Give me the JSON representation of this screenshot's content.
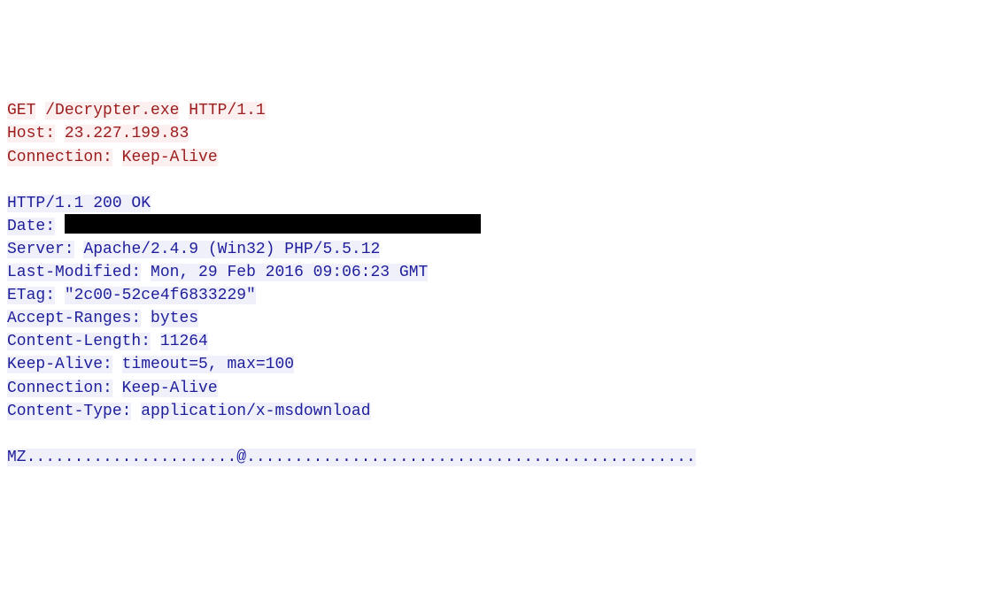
{
  "request": {
    "line1_method": "GET",
    "line1_path": "/Decrypter.exe",
    "line1_proto": "HTTP/1.1",
    "host_label": "Host:",
    "host_value": "23.227.199.83",
    "conn_label": "Connection:",
    "conn_value": "Keep-Alive"
  },
  "response": {
    "status": "HTTP/1.1 200 OK",
    "date_label": "Date:",
    "server_label": "Server:",
    "server_value": "Apache/2.4.9 (Win32) PHP/5.5.12",
    "lastmod_label": "Last-Modified:",
    "lastmod_value": "Mon, 29 Feb 2016 09:06:23 GMT",
    "etag_label": "ETag:",
    "etag_value": "\"2c00-52ce4f6833229\"",
    "acceptranges_label": "Accept-Ranges:",
    "acceptranges_value": "bytes",
    "contentlength_label": "Content-Length:",
    "contentlength_value": "11264",
    "keepalive_label": "Keep-Alive:",
    "keepalive_value": "timeout=5, max=100",
    "conn_label": "Connection:",
    "conn_value": "Keep-Alive",
    "contenttype_label": "Content-Type:",
    "contenttype_value": "application/x-msdownload",
    "body": "MZ......................@..............................................."
  }
}
